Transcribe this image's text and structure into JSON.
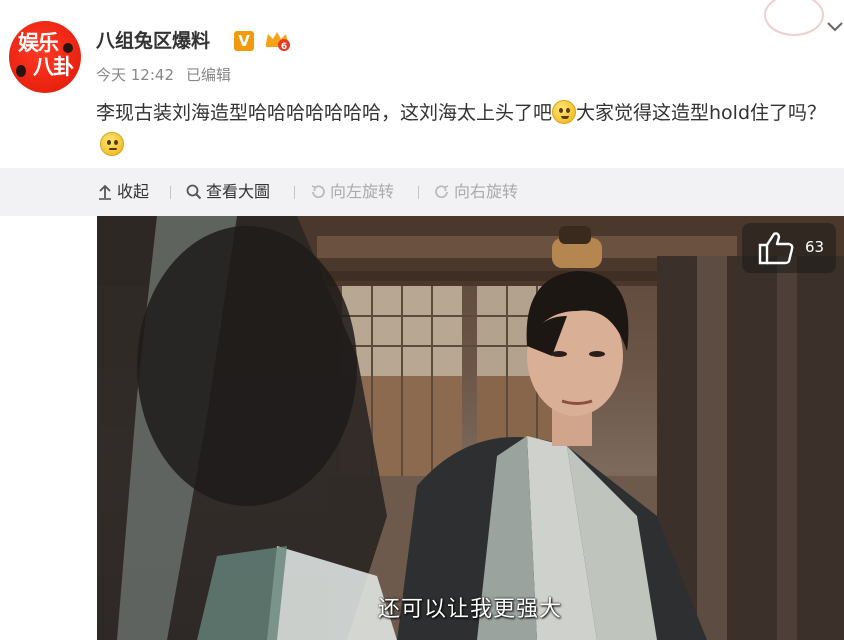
{
  "post": {
    "username": "八组兔区爆料",
    "verified_label": "V",
    "level_icon": "level-badge-icon",
    "timestamp": "今天 12:42",
    "edited_label": "已编辑",
    "text_part1": "李现古装刘海造型哈哈哈哈哈哈哈，这刘海太上头了吧",
    "text_part2": "大家觉得这造型hold住了吗？",
    "avatar": {
      "line1": "娱乐",
      "line2": "八卦"
    },
    "emoji_1": "laughing-crying-emoji",
    "emoji_2": "thinking-emoji"
  },
  "toolbar": {
    "collapse_label": "收起",
    "view_large_label": "查看大圖",
    "rotate_left_label": "向左旋转",
    "rotate_right_label": "向右旋转"
  },
  "media": {
    "like_count": "63",
    "subtitle": "还可以让我更强大"
  },
  "colors": {
    "username": "#333333",
    "meta": "#888888",
    "toolbar_bg": "#f2f2f5",
    "verified_badge": "#f29a0c",
    "avatar_bg": "#e8220f",
    "disabled_text": "#aaaaaa"
  }
}
